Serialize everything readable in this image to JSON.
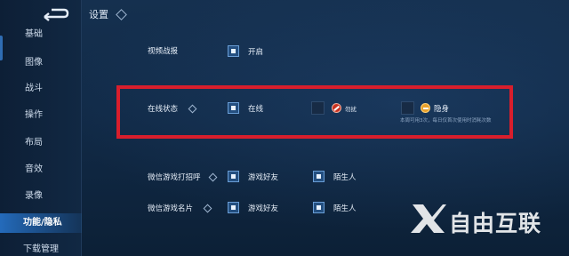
{
  "header": {
    "title": "设置"
  },
  "sidebar": {
    "items": [
      {
        "label": "基础"
      },
      {
        "label": "图像"
      },
      {
        "label": "战斗"
      },
      {
        "label": "操作"
      },
      {
        "label": "布局"
      },
      {
        "label": "音效"
      },
      {
        "label": "录像"
      },
      {
        "label": "功能/隐私"
      },
      {
        "label": "下载管理"
      }
    ],
    "active_index": 7
  },
  "rows": {
    "video_report": {
      "label": "视频战报",
      "option_label": "开启",
      "checked": true
    },
    "online_status": {
      "label": "在线状态",
      "options": [
        {
          "label": "在线",
          "checked": true
        },
        {
          "label": "勿扰",
          "checked": false,
          "icon": "do-not-disturb-icon"
        },
        {
          "label": "隐身",
          "checked": false,
          "icon": "invisible-icon"
        }
      ],
      "note": "本周可用3次，每日仅首次使用时消耗次数"
    },
    "wechat_greeting": {
      "label": "微信游戏打招呼",
      "options": [
        {
          "label": "游戏好友",
          "checked": true
        },
        {
          "label": "陌生人",
          "checked": true
        }
      ]
    },
    "wechat_card": {
      "label": "微信游戏名片",
      "options": [
        {
          "label": "游戏好友",
          "checked": true
        },
        {
          "label": "陌生人",
          "checked": true
        }
      ]
    }
  },
  "watermark": {
    "text": "自由互联"
  },
  "colors": {
    "background": "#112a47",
    "accent": "#2878d2",
    "highlight_box": "#d81e2c",
    "checkbox_fill": "#244f80"
  }
}
